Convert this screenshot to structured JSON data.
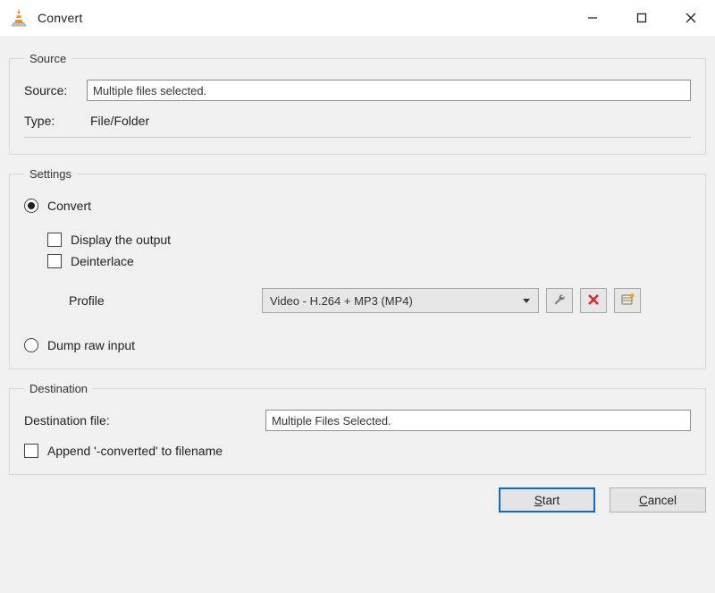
{
  "window": {
    "title": "Convert"
  },
  "source": {
    "legend": "Source",
    "source_label": "Source:",
    "source_value": "Multiple files selected.",
    "type_label": "Type:",
    "type_value": "File/Folder"
  },
  "settings": {
    "legend": "Settings",
    "convert_label": "Convert",
    "display_output_label": "Display the output",
    "deinterlace_label": "Deinterlace",
    "profile_label": "Profile",
    "profile_value": "Video - H.264 + MP3 (MP4)",
    "dump_raw_label": "Dump raw input"
  },
  "destination": {
    "legend": "Destination",
    "file_label": "Destination file:",
    "file_value": "Multiple Files Selected.",
    "append_label": "Append '-converted' to filename"
  },
  "buttons": {
    "start": "Start",
    "cancel": "Cancel"
  },
  "icons": {
    "wrench": "wrench-icon",
    "delete": "delete-icon",
    "new_profile": "new-profile-icon"
  }
}
